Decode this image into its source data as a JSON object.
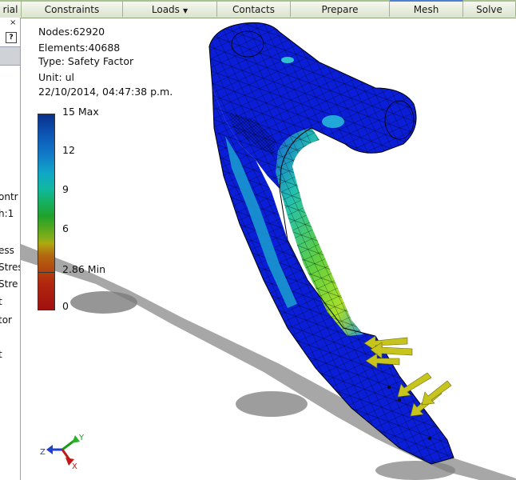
{
  "ribbon": {
    "tabs": [
      {
        "label": "rial"
      },
      {
        "label": "Constraints"
      },
      {
        "label": "Loads"
      },
      {
        "label": "Contacts"
      },
      {
        "label": "Prepare"
      },
      {
        "label": "Mesh"
      },
      {
        "label": "Solve"
      }
    ]
  },
  "panel": {
    "close_glyph": "×",
    "help_glyph": "?",
    "tree": [
      "ontr",
      "h:1",
      "ess",
      "Stres",
      "Stre",
      "t",
      "tor",
      "t"
    ]
  },
  "results": {
    "nodes": "Nodes:62920",
    "elements": "Elements:40688",
    "type": "Type: Safety Factor",
    "unit": "Unit: ul",
    "timestamp": "22/10/2014, 04:47:38 p.m."
  },
  "legend": {
    "max_label": "15 Max",
    "tick_12": "12",
    "tick_9": "9",
    "tick_6": "6",
    "min_label": "2.86 Min",
    "tick_0": "0"
  },
  "triad": {
    "y": "Y",
    "z": "Z",
    "x": "X"
  },
  "colors": {
    "mesh_blue": "#0a1ed8",
    "load_arrow": "#c8c41e",
    "shadow": "#8a8a8a"
  }
}
